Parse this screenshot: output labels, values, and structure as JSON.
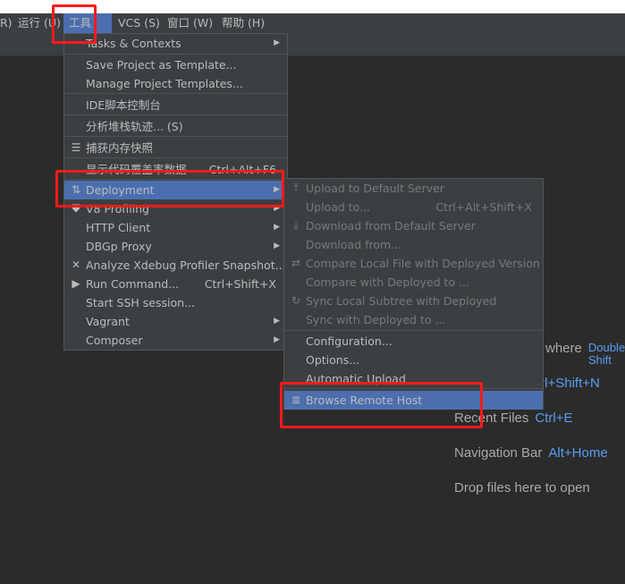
{
  "menubar": {
    "items": [
      {
        "label": "R)"
      },
      {
        "label": "运行 (U)"
      },
      {
        "label": "工具 (T)"
      },
      {
        "label": "VCS (S)"
      },
      {
        "label": "窗口 (W)"
      },
      {
        "label": "帮助 (H)"
      }
    ]
  },
  "tools_menu": {
    "items": [
      {
        "label": "Tasks & Contexts",
        "submenu": true
      },
      {
        "label": "Save Project as Template..."
      },
      {
        "label": "Manage Project Templates..."
      },
      {
        "label": "IDE脚本控制台"
      },
      {
        "label": "分析堆栈轨迹... (S)"
      },
      {
        "label": "捕获内存快照",
        "icon": "memory-snapshot-icon"
      },
      {
        "label": "显示代码覆盖率数据",
        "shortcut": "Ctrl+Alt+F6"
      },
      {
        "label": "Deployment",
        "icon": "deployment-icon",
        "submenu": true,
        "selected": true
      },
      {
        "label": "V8 Profiling",
        "icon": "v8-shield-icon",
        "submenu": true
      },
      {
        "label": "HTTP Client",
        "submenu": true
      },
      {
        "label": "DBGp Proxy",
        "submenu": true
      },
      {
        "label": "Analyze Xdebug Profiler Snapshot...",
        "icon": "xdebug-icon"
      },
      {
        "label": "Run Command...",
        "shortcut": "Ctrl+Shift+X",
        "icon": "terminal-icon"
      },
      {
        "label": "Start SSH session..."
      },
      {
        "label": "Vagrant",
        "submenu": true
      },
      {
        "label": "Composer",
        "submenu": true
      }
    ]
  },
  "deployment_menu": {
    "items": [
      {
        "label": "Upload to Default Server",
        "disabled": true,
        "icon": "upload-icon"
      },
      {
        "label": "Upload to...",
        "shortcut": "Ctrl+Alt+Shift+X",
        "disabled": true
      },
      {
        "label": "Download from Default Server",
        "disabled": true,
        "icon": "download-icon"
      },
      {
        "label": "Download from...",
        "disabled": true
      },
      {
        "label": "Compare Local File with Deployed Version",
        "disabled": true,
        "icon": "compare-icon"
      },
      {
        "label": "Compare with Deployed to ...",
        "disabled": true
      },
      {
        "label": "Sync Local Subtree with Deployed",
        "disabled": true,
        "icon": "sync-icon"
      },
      {
        "label": "Sync with Deployed to ...",
        "disabled": true
      },
      {
        "label": "Configuration..."
      },
      {
        "label": "Options..."
      },
      {
        "label": "Automatic Upload"
      },
      {
        "label": "Browse Remote Host",
        "icon": "server-list-icon",
        "selected": true
      }
    ]
  },
  "welcome": {
    "lines": [
      {
        "label": "where",
        "key": "Double Shift"
      },
      {
        "label": "",
        "key": "trl+Shift+N"
      },
      {
        "label": "Recent Files",
        "key": "Ctrl+E"
      },
      {
        "label": "Navigation Bar",
        "key": "Alt+Home"
      },
      {
        "label": "Drop files here to open",
        "key": ""
      }
    ]
  },
  "colors": {
    "selection": "#4b6eaf",
    "menu_bg": "#3c3f41",
    "editor_bg": "#2b2b2b",
    "shortcut_link": "#589df6",
    "highlight_box": "#ff1a1a"
  }
}
